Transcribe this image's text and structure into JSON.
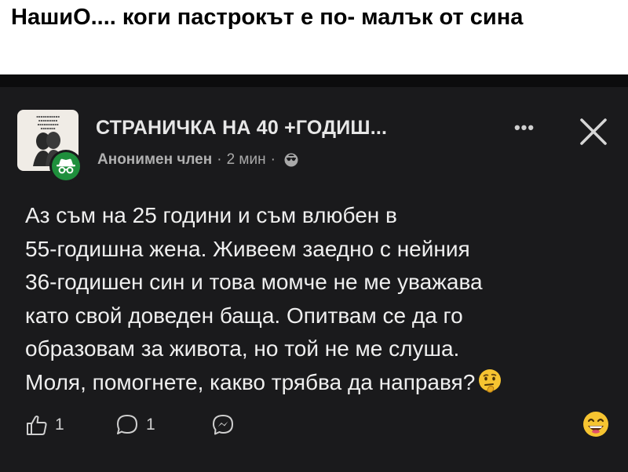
{
  "caption": {
    "text": "НашиО.... коги пастрокът е по- малък от сина"
  },
  "post": {
    "group_name": "СТРАНИЧКА НА 40 +ГОДИШ...",
    "author": "Анонимен член",
    "separator": "·",
    "time": "2 мин",
    "body": "Аз съм на 25 години и съм влюбен в\n55-годишна жена. Живеем заедно с нейния\n36-годишен син и това момче не ме уважава\nкато свой доведен баща. Опитвам се да го\nобразовам за живота, но той не ме слуша.\nМоля, помогнете, какво трябва да направя?",
    "more_label": "•••"
  },
  "actions": {
    "like_count": "1",
    "comment_count": "1"
  },
  "icons": {
    "like": "thumbs-up-icon",
    "comment": "comment-icon",
    "share": "messenger-icon",
    "close": "close-icon",
    "privacy": "globe-icon",
    "reaction": "grinning-emoji-icon",
    "thinking": "thinking-emoji-icon"
  },
  "colors": {
    "background": "#1a1a1c",
    "text": "#efefef",
    "muted": "#a9a9a9",
    "anonymous_badge": "#1e8f3c"
  }
}
